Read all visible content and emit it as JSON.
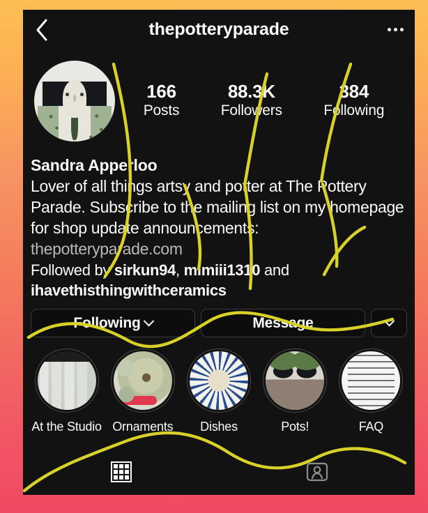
{
  "header": {
    "back_icon": "back-chevron-icon",
    "username": "thepotteryparade",
    "more_icon": "more-options-icon"
  },
  "profile": {
    "avatar_alt": "ceramic-figure-avatar",
    "full_name": "Sandra Apperloo",
    "bio": "Lover of all things artsy and potter at The Pottery Parade. Subscribe to the mailing list on my homepage for shop update announcements:",
    "link": "thepotteryparade.com",
    "followed_by_prefix": "Followed by ",
    "followed_by_1": "sirkun94",
    "followed_by_sep": ", ",
    "followed_by_2": "mimiii1310",
    "followed_by_and": " and ",
    "followed_by_3": "ihavethisthingwithceramics"
  },
  "stats": [
    {
      "num": "166",
      "label": "Posts"
    },
    {
      "num": "88.3K",
      "label": "Followers"
    },
    {
      "num": "384",
      "label": "Following"
    }
  ],
  "actions": {
    "following_label": "Following",
    "following_chevron": "chevron-down-icon",
    "message_label": "Message",
    "more_chevron": "chevron-down-icon"
  },
  "highlights": [
    {
      "label": "At the Studio",
      "cover": "cov-studio"
    },
    {
      "label": "Ornaments",
      "cover": "cov-orn"
    },
    {
      "label": "Dishes",
      "cover": "cov-dishes"
    },
    {
      "label": "Pots!",
      "cover": "cov-pots"
    },
    {
      "label": "FAQ",
      "cover": "cov-faq"
    }
  ],
  "tabs": [
    {
      "name": "grid-tab",
      "icon": "grid-icon",
      "active": true
    },
    {
      "name": "tagged-tab",
      "icon": "tagged-icon",
      "active": false
    }
  ],
  "colors": {
    "frame_top": "#fdbe55",
    "frame_mid": "#f4815c",
    "frame_bottom": "#ef4a63",
    "screen_bg": "#121212",
    "text_primary": "#fafafa",
    "text_muted": "#b9b9b9",
    "annotation": "#d8d12a"
  }
}
